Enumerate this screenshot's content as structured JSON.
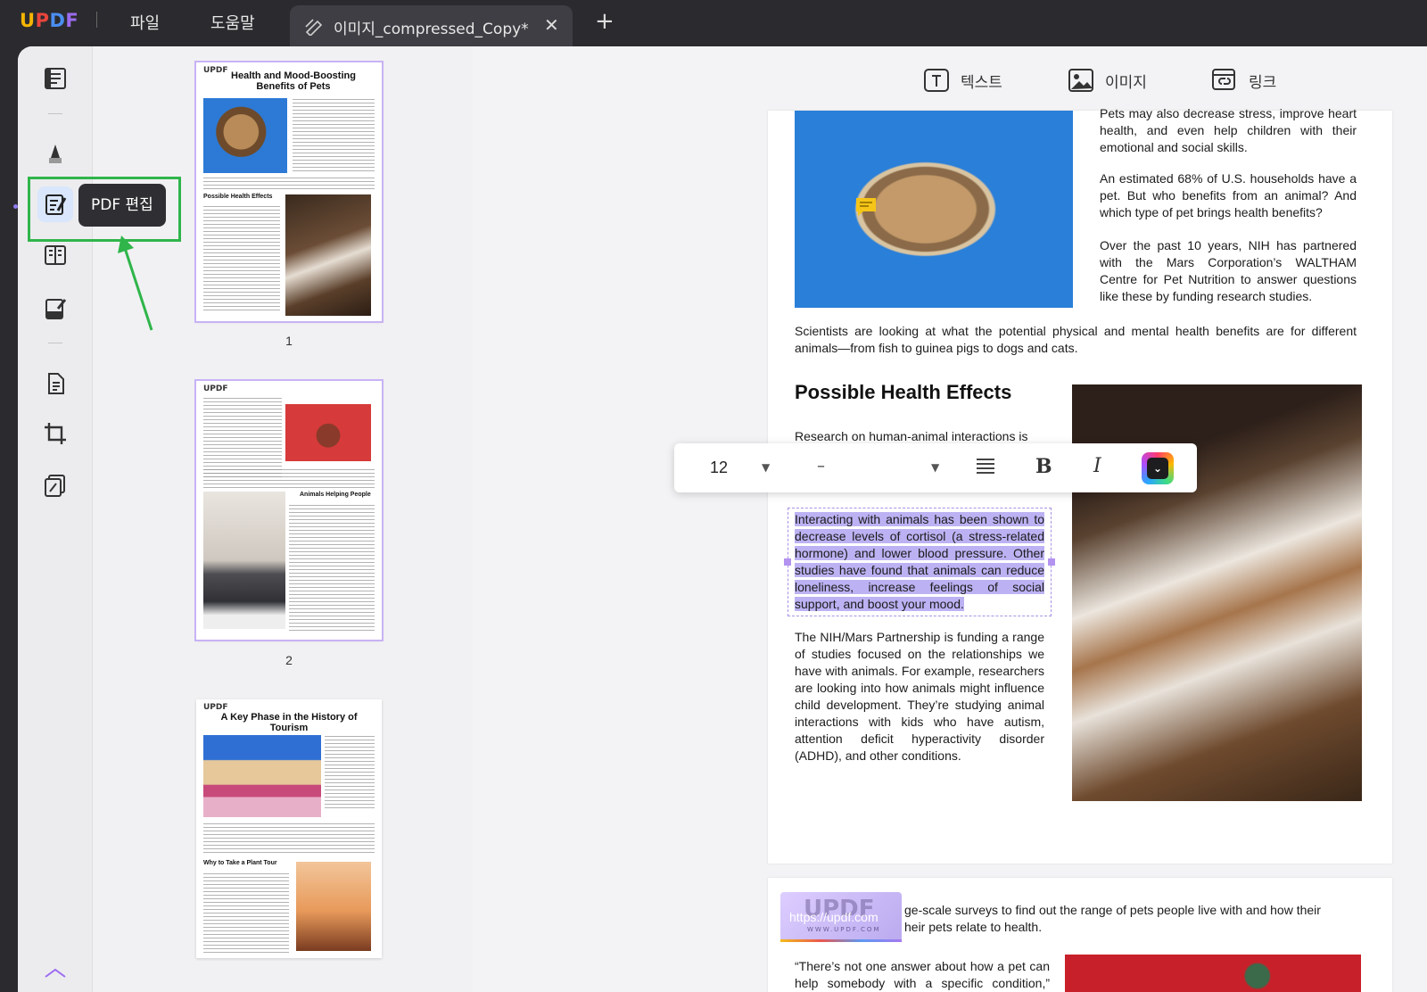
{
  "app": {
    "logo": "UPDF",
    "menu_file": "파일",
    "menu_help": "도움말",
    "tab_title": "이미지_compressed_Copy*",
    "tab_close": "✕",
    "new_tab": "+"
  },
  "tools": [
    {
      "name": "reader-icon"
    },
    {
      "name": "highlighter-icon"
    },
    {
      "name": "edit-pdf-icon"
    },
    {
      "name": "organize-pages-icon"
    },
    {
      "name": "fill-sign-icon"
    },
    {
      "name": "convert-icon"
    },
    {
      "name": "crop-icon"
    },
    {
      "name": "compress-icon"
    }
  ],
  "tooltip": "PDF 편집",
  "edit_toolbar": {
    "text": "텍스트",
    "image": "이미지",
    "link": "링크"
  },
  "thumbnails": [
    {
      "page": "1",
      "logo": "UPDF",
      "title": "Health and Mood-Boosting Benefits of Pets",
      "section": "Possible Health Effects"
    },
    {
      "page": "2",
      "logo": "UPDF",
      "section": "Animals Helping People"
    },
    {
      "logo": "UPDF",
      "title": "A Key Phase in the History of Tourism",
      "section": "Why to Take a Plant Tour"
    }
  ],
  "page1": {
    "p1": "Pets may also decrease stress, improve heart health, and even help children with their emotional and social skills.",
    "p2": "An estimated 68% of U.S. households have a pet. But who benefits from an animal? And which type of pet brings health benefits?",
    "p3": "Over the past 10 years, NIH has partnered with the Mars Corporation’s WALTHAM Centre for Pet Nutrition to answer questions like these by funding research studies.",
    "p4": "Scientists are looking at what the potential physical and mental health benefits are for different animals—from fish to guinea pigs to dogs and cats.",
    "heading": "Possible Health Effects",
    "p5": "Research on human-animal interactions is",
    "selected": "Interacting with animals has been shown to decrease levels of cortisol (a stress-related hormone) and lower blood pressure. Other studies have found that animals can reduce loneliness, increase feelings of social support, and boost your mood.",
    "p6": "The NIH/Mars Partnership is funding a range of studies focused on the relationships we have with animals. For example, researchers are looking into how animals might influence child development. They’re studying animal interactions with kids who have autism, attention deficit hyperactivity disorder (ADHD), and other conditions."
  },
  "format_bar": {
    "font_size": "12",
    "font_name": "–"
  },
  "page2": {
    "watermark_logo": "UPDF",
    "watermark_url": "https://updf.com",
    "watermark_sub": "WWW.UPDF.COM",
    "p1": "ge-scale surveys to find out the range of pets people live with and how their",
    "p1b": "heir pets relate to health.",
    "p2": "“There’s not one answer about how a pet can help somebody with a specific condition,” explains Dr. Layla Esposito, who oversees"
  },
  "colors": {
    "accent": "#4b8ef0",
    "selection": "#bcb2f3",
    "highlight_box": "#2fb54a"
  }
}
